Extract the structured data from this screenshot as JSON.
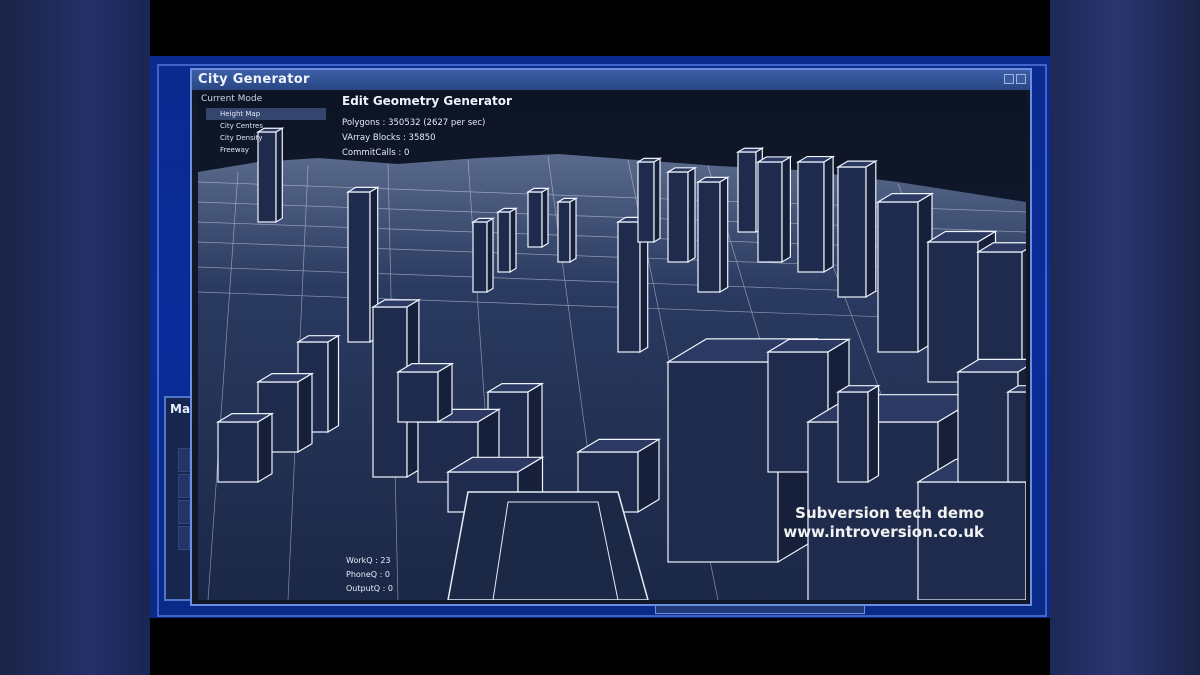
{
  "window": {
    "title": "City Generator"
  },
  "side_panel": {
    "title": "Ma"
  },
  "mode_panel": {
    "label": "Current Mode",
    "items": [
      {
        "label": "Height Map",
        "active": true
      },
      {
        "label": "City Centres",
        "active": false
      },
      {
        "label": "City Density",
        "active": false
      },
      {
        "label": "Freeway",
        "active": false
      }
    ]
  },
  "generator": {
    "title": "Edit Geometry Generator",
    "polygons": "Polygons : 350532 (2627 per sec)",
    "varray": "VArray Blocks : 35850",
    "commits": "CommitCalls : 0"
  },
  "queues": {
    "work": "WorkQ : 23",
    "phone": "PhoneQ : 0",
    "output": "OutputQ : 0"
  },
  "watermark": {
    "line1": "Subversion tech demo",
    "line2": "www.introversion.co.uk"
  },
  "colors": {
    "frame": "#6a8ee0",
    "desktop": "#0a2b9a",
    "wire": "#e8eef8",
    "building_fill": "#1f2b4d"
  }
}
